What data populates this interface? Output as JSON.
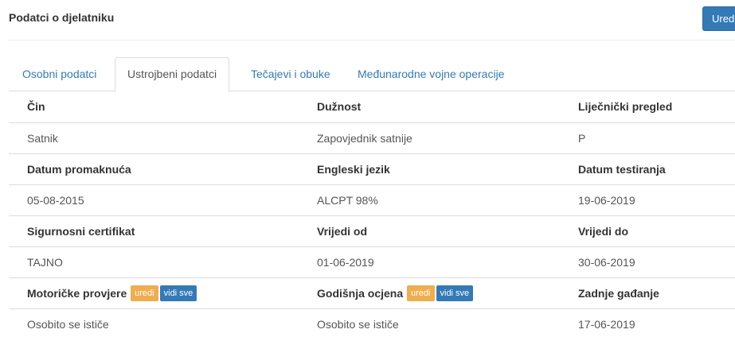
{
  "header": {
    "title": "Podatci o djelatniku",
    "edit_label": "Uredi"
  },
  "tabs": [
    {
      "label": "Osobni podatci",
      "active": false
    },
    {
      "label": "Ustrojbeni podatci",
      "active": true
    },
    {
      "label": "Tečajevi i obuke",
      "active": false
    },
    {
      "label": "Međunarodne vojne operacije",
      "active": false
    }
  ],
  "details": {
    "row1": {
      "labels": [
        "Čin",
        "Dužnost",
        "Liječnički pregled"
      ],
      "values": [
        "Satnik",
        "Zapovjednik satnije",
        "P"
      ]
    },
    "row2": {
      "labels": [
        "Datum promaknuća",
        "Engleski jezik",
        "Datum testiranja"
      ],
      "values": [
        "05-08-2015",
        "ALCPT 98%",
        "19-06-2019"
      ]
    },
    "row3": {
      "labels": [
        "Sigurnosni certifikat",
        "Vrijedi od",
        "Vrijedi do"
      ],
      "values": [
        "TAJNO",
        "01-06-2019",
        "30-06-2019"
      ]
    },
    "row4": {
      "labels": [
        "Motoričke provjere",
        "Godišnja ocjena",
        "Zadnje gađanje"
      ],
      "values": [
        "Osobito se ističe",
        "Osobito se ističe",
        "17-06-2019"
      ],
      "edit_badge": "uredi",
      "view_all_badge": "vidi sve"
    }
  },
  "colors": {
    "primary": "#337ab7",
    "warning": "#f0ad4e",
    "border": "#dddddd"
  }
}
